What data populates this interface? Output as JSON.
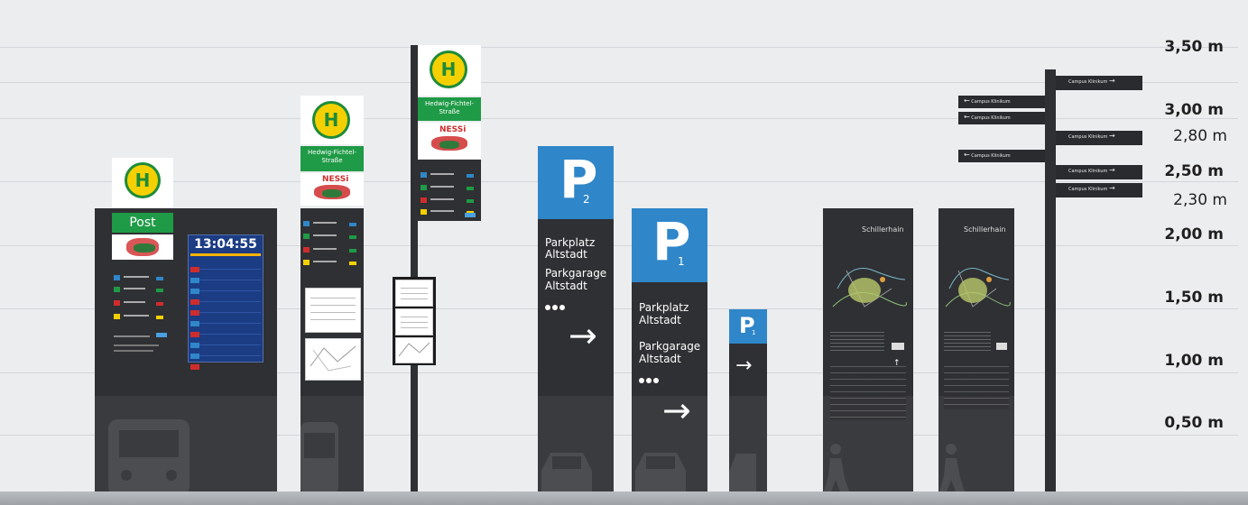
{
  "scale_labels": {
    "m350": "3,50 m",
    "m300": "3,00 m",
    "m280": "2,80 m",
    "m250": "2,50 m",
    "m230": "2,30 m",
    "m200": "2,00 m",
    "m150": "1,50 m",
    "m100": "1,00 m",
    "m050": "0,50 m"
  },
  "bus_stop_main": {
    "stop_name": "Post",
    "clock": "13:04:55"
  },
  "bus_stop_mid": {
    "stop_name": "Hedwig-Fichtel-Straße",
    "logo": "NESSi"
  },
  "bus_stop_pole": {
    "stop_name": "Hedwig-Fichtel-Straße",
    "logo": "NESSi"
  },
  "parking_p2": {
    "letter": "P",
    "number": "2",
    "line1": "Parkplatz",
    "line2": "Altstadt",
    "line3": "Parkgarage",
    "line4": "Altstadt",
    "arrow": "→"
  },
  "parking_p1": {
    "letter": "P",
    "number": "1",
    "line1": "Parkplatz",
    "line2": "Altstadt",
    "line3": "Parkgarage",
    "line4": "Altstadt",
    "arrow": "→"
  },
  "parking_small": {
    "letter": "P",
    "number": "1",
    "arrow": "→"
  },
  "map_stele_1": {
    "title": "Schillerhain"
  },
  "map_stele_2": {
    "title": "Schillerhain"
  },
  "direction_signs": {
    "right_label": "Campus Klinikum",
    "left_label": "Campus Klinikum",
    "right_arrow": "→",
    "left_arrow": "←"
  },
  "colors": {
    "sign_dark": "#2f3033",
    "bus_green": "#1f9a46",
    "bus_yellow": "#f5d000",
    "parking_blue": "#2f86c9"
  }
}
